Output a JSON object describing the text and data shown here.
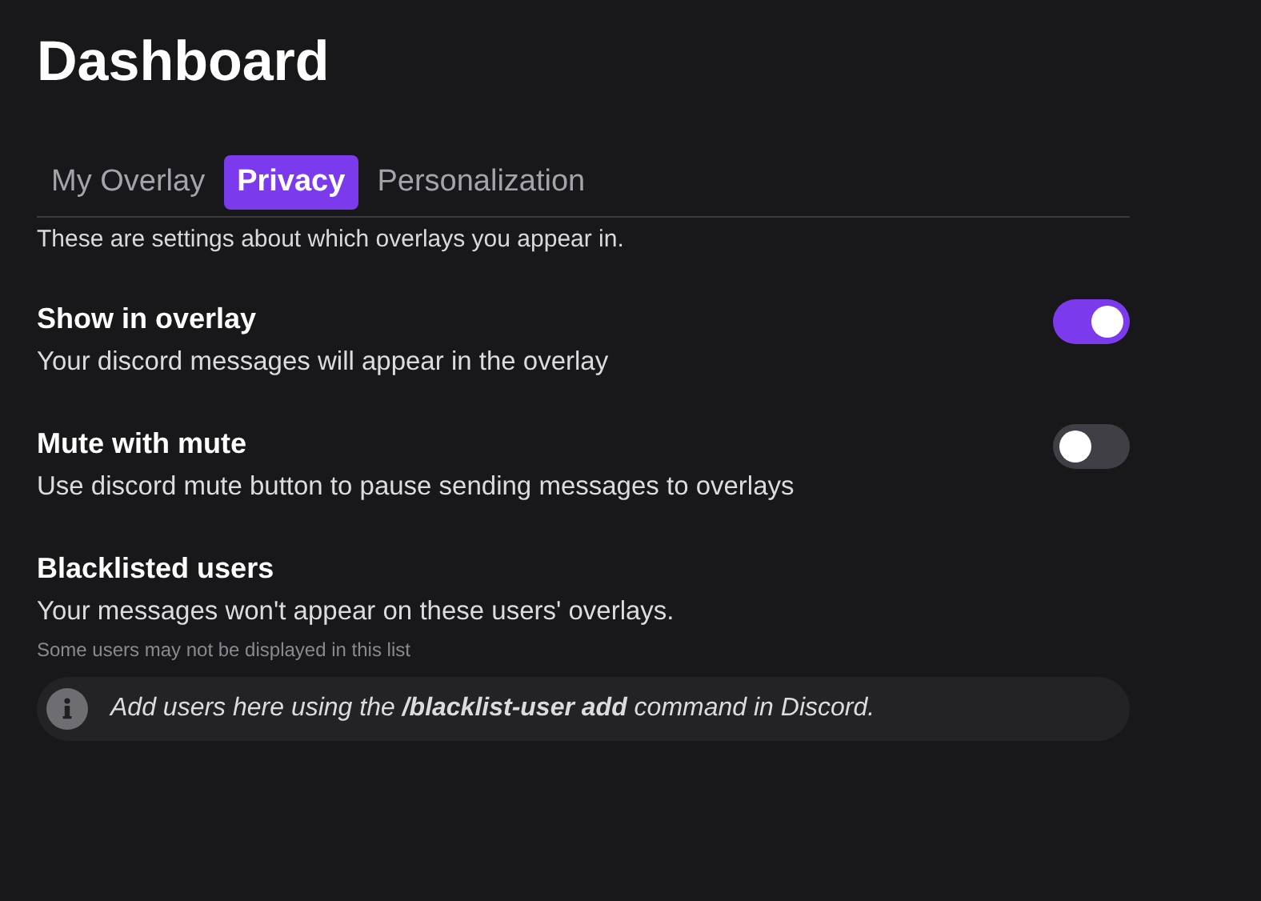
{
  "title": "Dashboard",
  "tabs": [
    {
      "label": "My Overlay",
      "selected": false
    },
    {
      "label": "Privacy",
      "selected": true
    },
    {
      "label": "Personalization",
      "selected": false
    }
  ],
  "description": "These are settings about which overlays you appear in.",
  "settings": [
    {
      "kind": "toggle",
      "title": "Show in overlay",
      "text": "Your discord messages will appear in the overlay",
      "on": true
    },
    {
      "kind": "toggle",
      "title": "Mute with mute",
      "text": "Use discord mute button to pause sending messages to overlays",
      "on": false
    },
    {
      "kind": "list",
      "title": "Blacklisted users",
      "text": "Your messages won't appear on these users' overlays.",
      "note": "Some users may not be displayed in this list",
      "info": "Add users here using the **/blacklist-user add** command in Discord."
    }
  ]
}
